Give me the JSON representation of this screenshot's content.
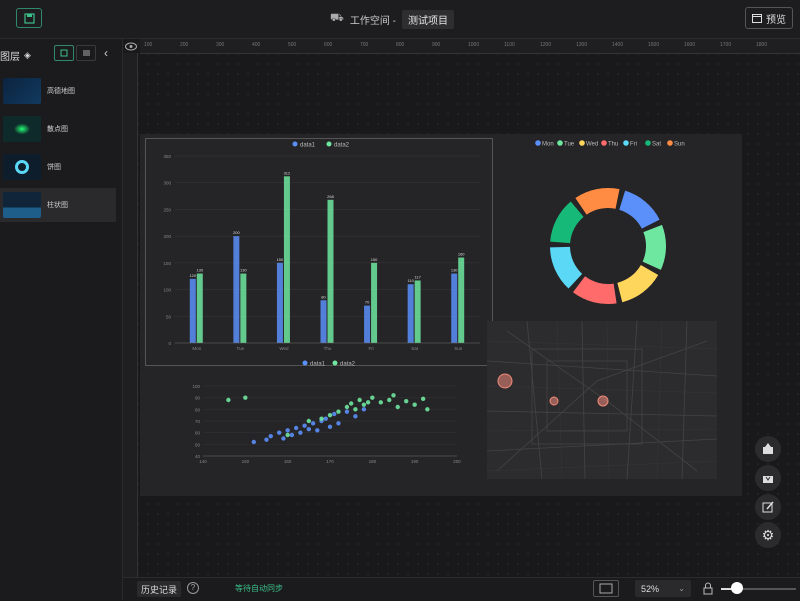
{
  "header": {
    "workspace_label": "工作空间 -",
    "project_name": "测试项目",
    "preview_label": "预览"
  },
  "sidebar": {
    "title": "图层",
    "items": [
      {
        "label": "高德地图"
      },
      {
        "label": "散点图"
      },
      {
        "label": "饼图"
      },
      {
        "label": "柱状图"
      }
    ]
  },
  "ruler": {
    "top_ticks": [
      "100",
      "200",
      "300",
      "400",
      "500",
      "600",
      "700",
      "800",
      "900",
      "1000",
      "1100",
      "1200",
      "1300",
      "1400",
      "1500",
      "1600",
      "1700",
      "1800"
    ]
  },
  "footer": {
    "history_label": "历史记录",
    "sync_status": "等待自动同步",
    "zoom_value": "52%"
  },
  "colors": {
    "accent": "#2e8a6a",
    "series1": "#5b8ff9",
    "series2": "#6ee7a0"
  },
  "chart_data": [
    {
      "type": "bar",
      "categories": [
        "Mon",
        "Tue",
        "Wed",
        "Thu",
        "Fri",
        "Sat",
        "Sun"
      ],
      "series": [
        {
          "name": "data1",
          "values": [
            120,
            200,
            150,
            80,
            70,
            110,
            130
          ]
        },
        {
          "name": "data2",
          "values": [
            130,
            130,
            312,
            268,
            150,
            117,
            160
          ]
        }
      ],
      "ylim": [
        0,
        350
      ],
      "yticks": [
        "0",
        "50",
        "100",
        "150",
        "200",
        "250",
        "300",
        "350"
      ],
      "legend": "top-center"
    },
    {
      "type": "pie",
      "labels": [
        "Mon",
        "Tue",
        "Wed",
        "Thu",
        "Fri",
        "Sat",
        "Sun"
      ],
      "values": [
        1,
        1,
        1,
        1,
        1,
        1,
        1
      ],
      "colors": [
        "#5b8ff9",
        "#6ee7a0",
        "#ffd65c",
        "#ff6b6b",
        "#5ad8f5",
        "#17b978",
        "#ff8c42"
      ],
      "legend": "top-center"
    },
    {
      "type": "scatter",
      "series": [
        {
          "name": "data1",
          "points": [
            [
              152,
              52
            ],
            [
              155,
              54
            ],
            [
              156,
              57
            ],
            [
              158,
              60
            ],
            [
              159,
              55
            ],
            [
              160,
              62
            ],
            [
              161,
              58
            ],
            [
              162,
              64
            ],
            [
              163,
              60
            ],
            [
              164,
              66
            ],
            [
              165,
              63
            ],
            [
              166,
              68
            ],
            [
              167,
              62
            ],
            [
              168,
              70
            ],
            [
              169,
              72
            ],
            [
              170,
              65
            ],
            [
              171,
              76
            ],
            [
              172,
              68
            ],
            [
              174,
              78
            ],
            [
              176,
              74
            ],
            [
              178,
              80
            ]
          ]
        },
        {
          "name": "data2",
          "points": [
            [
              146,
              88
            ],
            [
              150,
              90
            ],
            [
              160,
              58
            ],
            [
              165,
              70
            ],
            [
              168,
              72
            ],
            [
              170,
              75
            ],
            [
              172,
              78
            ],
            [
              174,
              82
            ],
            [
              175,
              85
            ],
            [
              176,
              80
            ],
            [
              177,
              88
            ],
            [
              178,
              84
            ],
            [
              179,
              86
            ],
            [
              180,
              90
            ],
            [
              182,
              86
            ],
            [
              184,
              88
            ],
            [
              185,
              92
            ],
            [
              186,
              82
            ],
            [
              188,
              87
            ],
            [
              190,
              84
            ],
            [
              192,
              89
            ],
            [
              193,
              80
            ]
          ]
        }
      ],
      "xlim": [
        140,
        200
      ],
      "ylim": [
        40,
        100
      ],
      "xticks": [
        "140",
        "150",
        "160",
        "170",
        "180",
        "190",
        "200"
      ],
      "yticks": [
        "40",
        "50",
        "60",
        "70",
        "80",
        "90",
        "100"
      ],
      "legend": "top-center"
    }
  ]
}
